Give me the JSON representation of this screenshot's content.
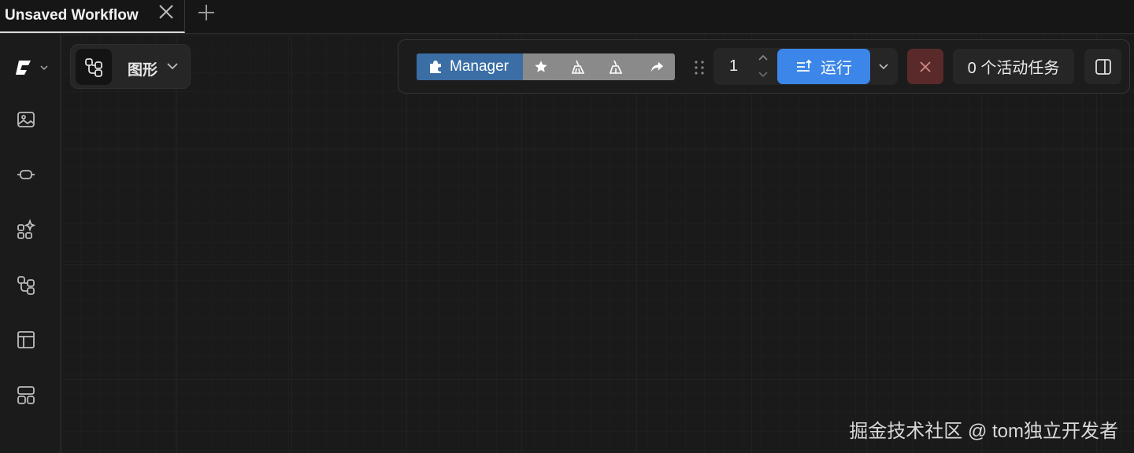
{
  "tabs": [
    {
      "label": "Unsaved Workflow",
      "active": true
    }
  ],
  "graph_mode": {
    "label": "图形",
    "icon": "workflow-icon"
  },
  "sidebar": {
    "logo": "comfy-logo-icon",
    "items": [
      {
        "icon": "image-icon"
      },
      {
        "icon": "node-connect-icon"
      },
      {
        "icon": "sparkle-apps-icon"
      },
      {
        "icon": "workflow-icon"
      },
      {
        "icon": "template-layout-icon"
      },
      {
        "icon": "grid-layout-icon"
      }
    ]
  },
  "toolbar": {
    "manager_label": "Manager",
    "queue_count": "1",
    "run_label": "运行",
    "active_tasks_label": "0 个活动任务",
    "icons": [
      "puzzle-icon",
      "star-icon",
      "broom-icon",
      "broom-alt-icon",
      "share-icon"
    ]
  },
  "watermark": "掘金技术社区 @ tom独立开发者",
  "colors": {
    "accent": "#3b86e8",
    "manager": "#3a6ea5",
    "cancel": "#5a2a2a",
    "background": "#1a1a1a"
  }
}
